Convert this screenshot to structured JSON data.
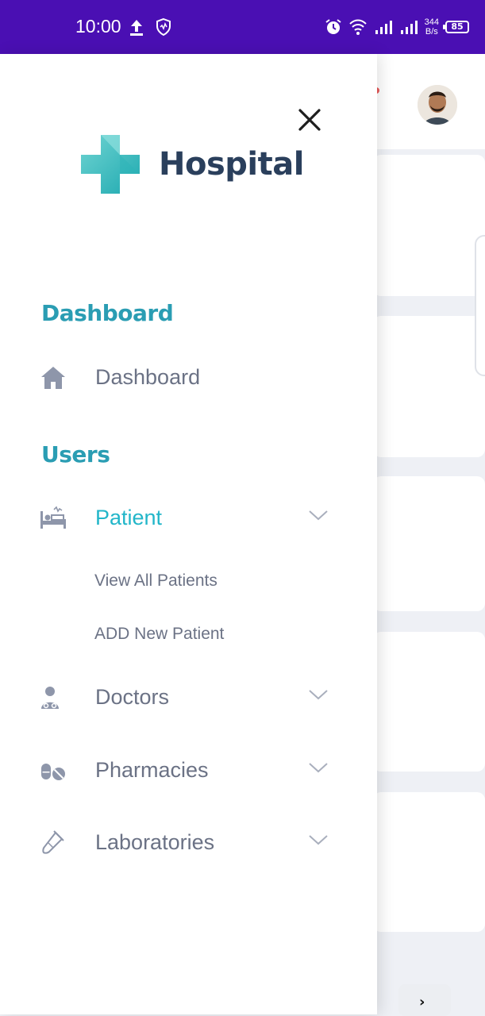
{
  "status_bar": {
    "time": "10:00",
    "net_speed_value": "344",
    "net_speed_unit": "B/s",
    "battery": "85"
  },
  "drawer": {
    "logo_text": "Hospital",
    "sections": {
      "dashboard_title": "Dashboard",
      "users_title": "Users"
    },
    "items": {
      "dashboard": "Dashboard",
      "patient": "Patient",
      "doctors": "Doctors",
      "pharmacies": "Pharmacies",
      "laboratories": "Laboratories"
    },
    "patient_submenu": {
      "view_all": "View All Patients",
      "add_new": "ADD New Patient"
    }
  },
  "colors": {
    "status_bar": "#4a0fb3",
    "accent": "#22b6c9",
    "section_title": "#2a9db3",
    "logo_text": "#2a3f5c",
    "menu_text": "#6b7285",
    "icon_gray": "#8e96aa"
  },
  "icons": {
    "close": "close-icon",
    "logo": "medical-cross-icon",
    "dashboard": "home-icon",
    "patient": "hospital-bed-icon",
    "doctors": "doctor-icon",
    "pharmacies": "pills-icon",
    "laboratories": "test-tube-icon",
    "expand": "chevron-down-icon"
  }
}
